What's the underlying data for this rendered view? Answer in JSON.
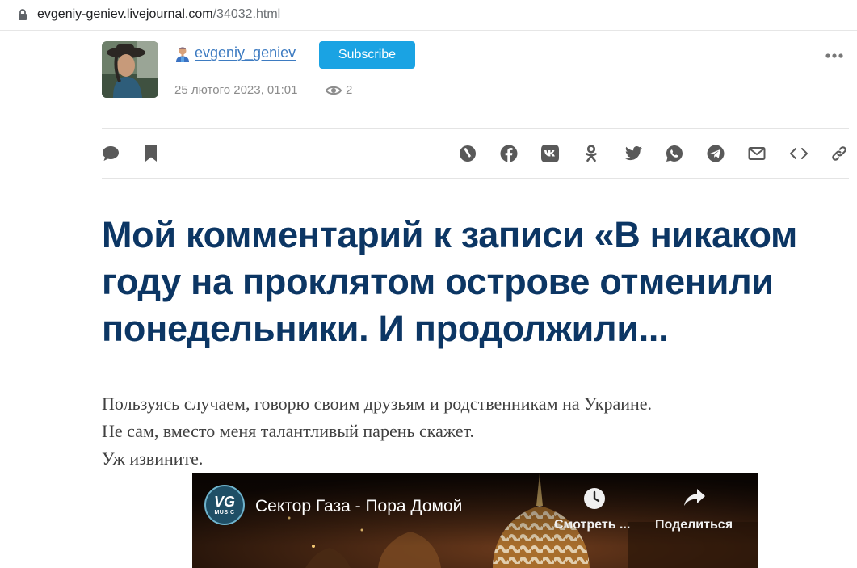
{
  "browser": {
    "url_domain": "evgeniy-geniev.livejournal.com",
    "url_path": "/34032.html"
  },
  "author": {
    "username": "evgeniy_geniev",
    "subscribe_label": "Subscribe",
    "date": "25 лютого 2023, 01:01",
    "views": "2"
  },
  "actions": {
    "left": [
      "comment-icon",
      "bookmark-icon"
    ],
    "share": [
      "livejournal-icon",
      "facebook-icon",
      "vk-icon",
      "odnoklassniki-icon",
      "twitter-icon",
      "whatsapp-icon",
      "telegram-icon",
      "email-icon",
      "embed-icon",
      "link-icon"
    ]
  },
  "post": {
    "title": "Мой комментарий к записи «В никаком году на проклятом острове отменили понедельники. И продолжили...",
    "lines": [
      "Пользуясь случаем, говорю своим друзьям и родственникам на Украине.",
      "Не сам, вместо меня талантливый парень скажет.",
      "Уж извините."
    ]
  },
  "video": {
    "channel_logo_text": "VG",
    "channel_logo_sub": "MUSIC",
    "title": "Сектор Газа - Пора Домой",
    "watch_later_label": "Смотреть ...",
    "share_label": "Поделиться"
  },
  "colors": {
    "title": "#0c3664",
    "link": "#3d7bc1",
    "subscribe": "#1aa3e3",
    "icon": "#595959"
  }
}
